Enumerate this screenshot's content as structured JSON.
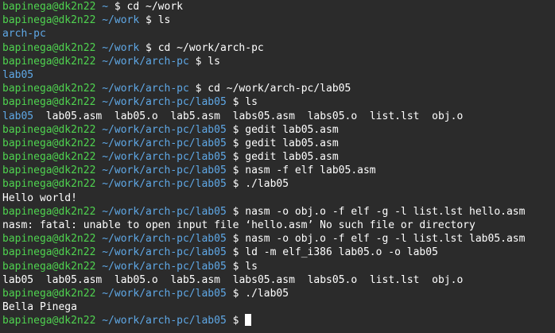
{
  "terminal": {
    "colors": {
      "background": "#2b2b2b",
      "user": "#4fd34f",
      "path": "#5fa8e6",
      "text": "#ffffff"
    },
    "lines": [
      {
        "type": "prompt",
        "user": "bapinega@dk2n22",
        "path": "~",
        "cmd": "cd ~/work"
      },
      {
        "type": "prompt",
        "user": "bapinega@dk2n22",
        "path": "~/work",
        "cmd": "ls"
      },
      {
        "type": "dirs",
        "items": [
          "arch-pc"
        ]
      },
      {
        "type": "prompt",
        "user": "bapinega@dk2n22",
        "path": "~/work",
        "cmd": "cd ~/work/arch-pc"
      },
      {
        "type": "prompt",
        "user": "bapinega@dk2n22",
        "path": "~/work/arch-pc",
        "cmd": "ls"
      },
      {
        "type": "dirs",
        "items": [
          "lab05"
        ]
      },
      {
        "type": "prompt",
        "user": "bapinega@dk2n22",
        "path": "~/work/arch-pc",
        "cmd": "cd ~/work/arch-pc/lab05"
      },
      {
        "type": "prompt",
        "user": "bapinega@dk2n22",
        "path": "~/work/arch-pc/lab05",
        "cmd": "ls"
      },
      {
        "type": "listing",
        "items": [
          {
            "text": "lab05",
            "dir": true
          },
          {
            "text": "lab05.asm",
            "dir": false
          },
          {
            "text": "lab05.o",
            "dir": false
          },
          {
            "text": "lab5.asm",
            "dir": false
          },
          {
            "text": "labs05.asm",
            "dir": false
          },
          {
            "text": "labs05.o",
            "dir": false
          },
          {
            "text": "list.lst",
            "dir": false
          },
          {
            "text": "obj.o",
            "dir": false
          }
        ]
      },
      {
        "type": "prompt",
        "user": "bapinega@dk2n22",
        "path": "~/work/arch-pc/lab05",
        "cmd": "gedit lab05.asm"
      },
      {
        "type": "prompt",
        "user": "bapinega@dk2n22",
        "path": "~/work/arch-pc/lab05",
        "cmd": "gedit lab05.asm"
      },
      {
        "type": "prompt",
        "user": "bapinega@dk2n22",
        "path": "~/work/arch-pc/lab05",
        "cmd": "gedit lab05.asm"
      },
      {
        "type": "prompt",
        "user": "bapinega@dk2n22",
        "path": "~/work/arch-pc/lab05",
        "cmd": "nasm -f elf lab05.asm"
      },
      {
        "type": "prompt",
        "user": "bapinega@dk2n22",
        "path": "~/work/arch-pc/lab05",
        "cmd": "./lab05"
      },
      {
        "type": "output",
        "text": "Hello world!"
      },
      {
        "type": "prompt",
        "user": "bapinega@dk2n22",
        "path": "~/work/arch-pc/lab05",
        "cmd": "nasm -o obj.o -f elf -g -l list.lst hello.asm"
      },
      {
        "type": "output",
        "text": "nasm: fatal: unable to open input file ‘hello.asm’ No such file or directory"
      },
      {
        "type": "prompt",
        "user": "bapinega@dk2n22",
        "path": "~/work/arch-pc/lab05",
        "cmd": "nasm -o obj.o -f elf -g -l list.lst lab05.asm"
      },
      {
        "type": "prompt",
        "user": "bapinega@dk2n22",
        "path": "~/work/arch-pc/lab05",
        "cmd": "ld -m elf_i386 lab05.o -o lab05"
      },
      {
        "type": "prompt",
        "user": "bapinega@dk2n22",
        "path": "~/work/arch-pc/lab05",
        "cmd": "ls"
      },
      {
        "type": "listing",
        "items": [
          {
            "text": "lab05",
            "dir": false
          },
          {
            "text": "lab05.asm",
            "dir": false
          },
          {
            "text": "lab05.o",
            "dir": false
          },
          {
            "text": "lab5.asm",
            "dir": false
          },
          {
            "text": "labs05.asm",
            "dir": false
          },
          {
            "text": "labs05.o",
            "dir": false
          },
          {
            "text": "list.lst",
            "dir": false
          },
          {
            "text": "obj.o",
            "dir": false
          }
        ]
      },
      {
        "type": "prompt",
        "user": "bapinega@dk2n22",
        "path": "~/work/arch-pc/lab05",
        "cmd": "./lab05"
      },
      {
        "type": "output",
        "text": "Bella Pinega"
      },
      {
        "type": "prompt",
        "user": "bapinega@dk2n22",
        "path": "~/work/arch-pc/lab05",
        "cmd": "",
        "cursor": true
      }
    ]
  }
}
